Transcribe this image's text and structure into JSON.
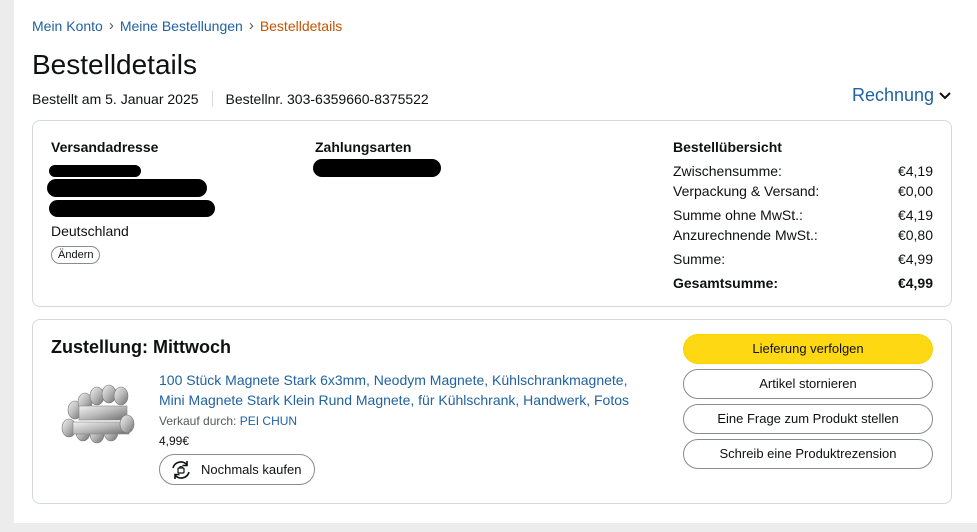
{
  "breadcrumb": {
    "account": "Mein Konto",
    "orders": "Meine Bestellungen",
    "current": "Bestelldetails",
    "separator": "›"
  },
  "header": {
    "title": "Bestelldetails",
    "ordered_on": "Bestellt am 5. Januar 2025",
    "order_number": "Bestellnr. 303-6359660-8375522",
    "invoice_label": "Rechnung"
  },
  "shipping": {
    "heading": "Versandadresse",
    "country": "Deutschland",
    "change_label": "Ändern"
  },
  "payment": {
    "heading": "Zahlungsarten"
  },
  "summary": {
    "heading": "Bestellübersicht",
    "rows": [
      {
        "label": "Zwischensumme:",
        "value": "€4,19"
      },
      {
        "label": "Verpackung & Versand:",
        "value": "€0,00"
      },
      {
        "label": "Summe ohne MwSt.:",
        "value": "€4,19"
      },
      {
        "label": "Anzurechnende MwSt.:",
        "value": "€0,80"
      },
      {
        "label": "Summe:",
        "value": "€4,99"
      }
    ],
    "total_label": "Gesamtsumme:",
    "total_value": "€4,99"
  },
  "delivery": {
    "status": "Zustellung: Mittwoch",
    "product_title_line1": "100 Stück Magnete Stark 6x3mm, Neodym Magnete, Kühlschrankmagnete,",
    "product_title_line2": "Mini Magnete Stark Klein Rund Magnete, für Kühlschrank, Handwerk, Fotos",
    "seller_prefix": "Verkauf durch:",
    "seller_name": "PEI CHUN",
    "price": "4,99€",
    "buy_again_label": "Nochmals kaufen"
  },
  "actions": {
    "track": "Lieferung verfolgen",
    "cancel": "Artikel stornieren",
    "question": "Eine Frage zum Produkt stellen",
    "review": "Schreib eine Produktrezension"
  },
  "colors": {
    "link": "#2162a1",
    "breadcrumb_current": "#c45500",
    "primary_button": "#ffd814",
    "border": "#d5d9d9"
  },
  "icons": {
    "invoice_chevron": "chevron-down-icon",
    "buy_again": "reorder-icon",
    "product": "magnet-stack-image"
  }
}
